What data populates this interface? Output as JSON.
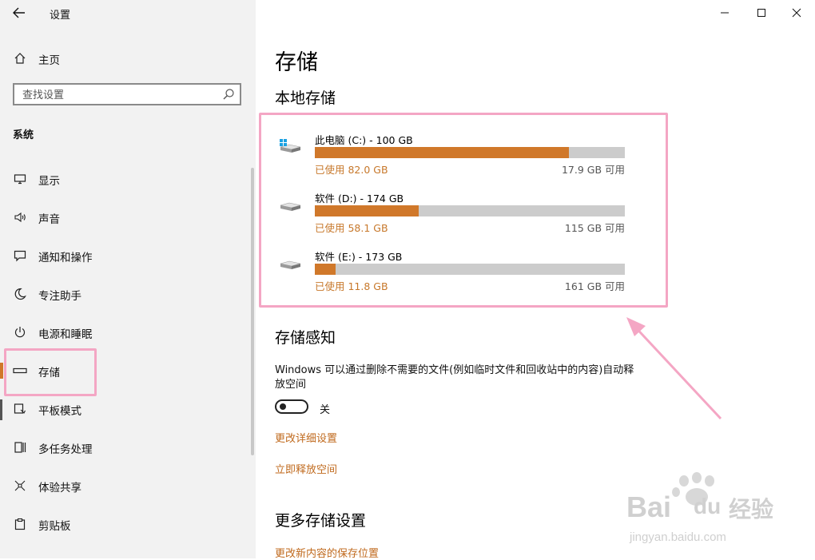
{
  "window": {
    "title": "设置"
  },
  "sidebar": {
    "home_label": "主页",
    "search_placeholder": "查找设置",
    "section_label": "系统",
    "items": [
      {
        "label": "显示",
        "icon": "monitor-icon"
      },
      {
        "label": "声音",
        "icon": "speaker-icon"
      },
      {
        "label": "通知和操作",
        "icon": "notification-icon"
      },
      {
        "label": "专注助手",
        "icon": "moon-icon"
      },
      {
        "label": "电源和睡眠",
        "icon": "power-icon"
      },
      {
        "label": "存储",
        "icon": "storage-icon",
        "selected": true
      },
      {
        "label": "平板模式",
        "icon": "tablet-icon"
      },
      {
        "label": "多任务处理",
        "icon": "multitask-icon"
      },
      {
        "label": "体验共享",
        "icon": "share-icon"
      },
      {
        "label": "剪贴板",
        "icon": "clipboard-icon"
      }
    ]
  },
  "main": {
    "title": "存储",
    "local_storage_title": "本地存储",
    "drives": [
      {
        "name": "此电脑 (C:) - 100 GB",
        "used": "已使用 82.0 GB",
        "free": "17.9 GB 可用",
        "used_fraction": 0.82,
        "icon": "windows-drive-icon"
      },
      {
        "name": "软件 (D:) - 174 GB",
        "used": "已使用 58.1 GB",
        "free": "115 GB 可用",
        "used_fraction": 0.334,
        "icon": "drive-icon"
      },
      {
        "name": "软件 (E:) - 173 GB",
        "used": "已使用 11.8 GB",
        "free": "161 GB 可用",
        "used_fraction": 0.068,
        "icon": "drive-icon"
      }
    ],
    "storage_sense": {
      "title": "存储感知",
      "description": "Windows 可以通过删除不需要的文件(例如临时文件和回收站中的内容)自动释放空间",
      "toggle_label": "关",
      "toggle_on": false,
      "link_change_settings": "更改详细设置",
      "link_free_now": "立即释放空间"
    },
    "more_settings": {
      "title": "更多存储设置",
      "link_save_location": "更改新内容的保存位置"
    }
  },
  "colors": {
    "accent": "#d0782a",
    "link": "#c06a1e",
    "highlight_box": "#f4a6c4",
    "sidebar_bg": "#f2f2f2",
    "bar_bg": "#cccccc"
  },
  "watermark": {
    "brand": "Bai",
    "brand2": "du",
    "cn": "经验",
    "url": "jingyan.baidu.com"
  }
}
